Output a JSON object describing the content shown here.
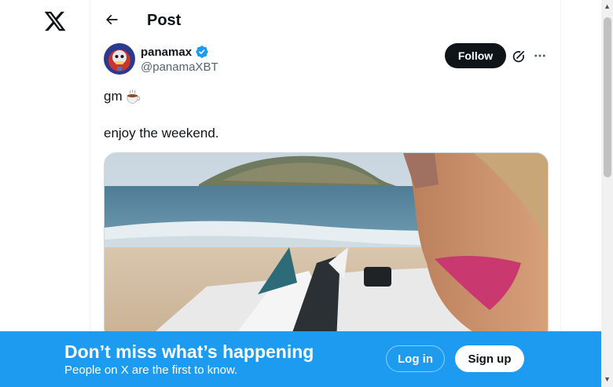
{
  "header": {
    "title": "Post"
  },
  "tweet": {
    "author_name": "panamax",
    "author_handle": "@panamaXBT",
    "follow_label": "Follow",
    "line1": "gm",
    "line2": "enjoy the weekend."
  },
  "icons": {
    "logo": "x-logo-icon",
    "back": "arrow-left-icon",
    "verified": "verified-badge-icon",
    "grok": "grok-icon",
    "more": "more-horizontal-icon",
    "emoji": "coffee-icon"
  },
  "banner": {
    "title": "Don’t miss what’s happening",
    "subtitle": "People on X are the first to know.",
    "login_label": "Log in",
    "signup_label": "Sign up"
  },
  "colors": {
    "brand_blue": "#1d9bf0",
    "text_primary": "#0f1419",
    "text_secondary": "#536471"
  }
}
